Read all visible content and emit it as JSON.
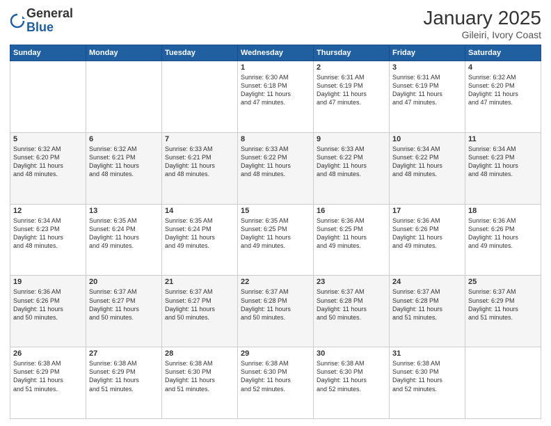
{
  "header": {
    "logo_general": "General",
    "logo_blue": "Blue",
    "month_title": "January 2025",
    "subtitle": "Gileiri, Ivory Coast"
  },
  "weekdays": [
    "Sunday",
    "Monday",
    "Tuesday",
    "Wednesday",
    "Thursday",
    "Friday",
    "Saturday"
  ],
  "weeks": [
    [
      {
        "day": "",
        "info": ""
      },
      {
        "day": "",
        "info": ""
      },
      {
        "day": "",
        "info": ""
      },
      {
        "day": "1",
        "info": "Sunrise: 6:30 AM\nSunset: 6:18 PM\nDaylight: 11 hours\nand 47 minutes."
      },
      {
        "day": "2",
        "info": "Sunrise: 6:31 AM\nSunset: 6:19 PM\nDaylight: 11 hours\nand 47 minutes."
      },
      {
        "day": "3",
        "info": "Sunrise: 6:31 AM\nSunset: 6:19 PM\nDaylight: 11 hours\nand 47 minutes."
      },
      {
        "day": "4",
        "info": "Sunrise: 6:32 AM\nSunset: 6:20 PM\nDaylight: 11 hours\nand 47 minutes."
      }
    ],
    [
      {
        "day": "5",
        "info": "Sunrise: 6:32 AM\nSunset: 6:20 PM\nDaylight: 11 hours\nand 48 minutes."
      },
      {
        "day": "6",
        "info": "Sunrise: 6:32 AM\nSunset: 6:21 PM\nDaylight: 11 hours\nand 48 minutes."
      },
      {
        "day": "7",
        "info": "Sunrise: 6:33 AM\nSunset: 6:21 PM\nDaylight: 11 hours\nand 48 minutes."
      },
      {
        "day": "8",
        "info": "Sunrise: 6:33 AM\nSunset: 6:22 PM\nDaylight: 11 hours\nand 48 minutes."
      },
      {
        "day": "9",
        "info": "Sunrise: 6:33 AM\nSunset: 6:22 PM\nDaylight: 11 hours\nand 48 minutes."
      },
      {
        "day": "10",
        "info": "Sunrise: 6:34 AM\nSunset: 6:22 PM\nDaylight: 11 hours\nand 48 minutes."
      },
      {
        "day": "11",
        "info": "Sunrise: 6:34 AM\nSunset: 6:23 PM\nDaylight: 11 hours\nand 48 minutes."
      }
    ],
    [
      {
        "day": "12",
        "info": "Sunrise: 6:34 AM\nSunset: 6:23 PM\nDaylight: 11 hours\nand 48 minutes."
      },
      {
        "day": "13",
        "info": "Sunrise: 6:35 AM\nSunset: 6:24 PM\nDaylight: 11 hours\nand 49 minutes."
      },
      {
        "day": "14",
        "info": "Sunrise: 6:35 AM\nSunset: 6:24 PM\nDaylight: 11 hours\nand 49 minutes."
      },
      {
        "day": "15",
        "info": "Sunrise: 6:35 AM\nSunset: 6:25 PM\nDaylight: 11 hours\nand 49 minutes."
      },
      {
        "day": "16",
        "info": "Sunrise: 6:36 AM\nSunset: 6:25 PM\nDaylight: 11 hours\nand 49 minutes."
      },
      {
        "day": "17",
        "info": "Sunrise: 6:36 AM\nSunset: 6:26 PM\nDaylight: 11 hours\nand 49 minutes."
      },
      {
        "day": "18",
        "info": "Sunrise: 6:36 AM\nSunset: 6:26 PM\nDaylight: 11 hours\nand 49 minutes."
      }
    ],
    [
      {
        "day": "19",
        "info": "Sunrise: 6:36 AM\nSunset: 6:26 PM\nDaylight: 11 hours\nand 50 minutes."
      },
      {
        "day": "20",
        "info": "Sunrise: 6:37 AM\nSunset: 6:27 PM\nDaylight: 11 hours\nand 50 minutes."
      },
      {
        "day": "21",
        "info": "Sunrise: 6:37 AM\nSunset: 6:27 PM\nDaylight: 11 hours\nand 50 minutes."
      },
      {
        "day": "22",
        "info": "Sunrise: 6:37 AM\nSunset: 6:28 PM\nDaylight: 11 hours\nand 50 minutes."
      },
      {
        "day": "23",
        "info": "Sunrise: 6:37 AM\nSunset: 6:28 PM\nDaylight: 11 hours\nand 50 minutes."
      },
      {
        "day": "24",
        "info": "Sunrise: 6:37 AM\nSunset: 6:28 PM\nDaylight: 11 hours\nand 51 minutes."
      },
      {
        "day": "25",
        "info": "Sunrise: 6:37 AM\nSunset: 6:29 PM\nDaylight: 11 hours\nand 51 minutes."
      }
    ],
    [
      {
        "day": "26",
        "info": "Sunrise: 6:38 AM\nSunset: 6:29 PM\nDaylight: 11 hours\nand 51 minutes."
      },
      {
        "day": "27",
        "info": "Sunrise: 6:38 AM\nSunset: 6:29 PM\nDaylight: 11 hours\nand 51 minutes."
      },
      {
        "day": "28",
        "info": "Sunrise: 6:38 AM\nSunset: 6:30 PM\nDaylight: 11 hours\nand 51 minutes."
      },
      {
        "day": "29",
        "info": "Sunrise: 6:38 AM\nSunset: 6:30 PM\nDaylight: 11 hours\nand 52 minutes."
      },
      {
        "day": "30",
        "info": "Sunrise: 6:38 AM\nSunset: 6:30 PM\nDaylight: 11 hours\nand 52 minutes."
      },
      {
        "day": "31",
        "info": "Sunrise: 6:38 AM\nSunset: 6:30 PM\nDaylight: 11 hours\nand 52 minutes."
      },
      {
        "day": "",
        "info": ""
      }
    ]
  ]
}
